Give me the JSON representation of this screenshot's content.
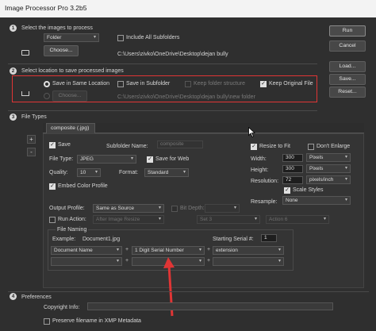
{
  "window": {
    "title": "Image Processor Pro 3.2b5"
  },
  "section1": {
    "number": "1",
    "label": "Select the images to process",
    "source_select": "Folder",
    "include_subfolders": "Include All Subfolders",
    "choose_button": "Choose...",
    "source_path": "C:\\Users\\zivko\\OneDrive\\Desktop\\dejan bully"
  },
  "section2": {
    "number": "2",
    "label": "Select location to save processed images",
    "save_same_location": "Save in Same Location",
    "save_in_subfolder": "Save in Subfolder",
    "keep_folder_structure": "Keep folder structure",
    "keep_original_file": "Keep Original File",
    "choose_button": "Choose...",
    "dest_path": "C:\\Users\\zivko\\OneDrive\\Desktop\\dejan bully\\new folder"
  },
  "section3": {
    "number": "3",
    "label": "File Types",
    "tab_label": "composite (.jpg)",
    "add_icon": "+",
    "remove_icon": "-",
    "save_label": "Save",
    "subfolder_name_label": "Subfolder Name:",
    "subfolder_name_value": "composite",
    "file_type_label": "File Type:",
    "file_type_value": "JPEG",
    "save_for_web": "Save for Web",
    "quality_label": "Quality:",
    "quality_value": "10",
    "format_label": "Format:",
    "format_value": "Standard",
    "embed_color_profile": "Embed Color Profile",
    "resize_to_fit": "Resize to Fit",
    "dont_enlarge": "Don't Enlarge",
    "width_label": "Width:",
    "width_value": "300",
    "width_unit": "Pixels",
    "height_label": "Height:",
    "height_value": "300",
    "height_unit": "Pixels",
    "resolution_label": "Resolution:",
    "resolution_value": "72",
    "resolution_unit": "pixels/inch",
    "scale_styles": "Scale Styles",
    "resample_label": "Resample:",
    "resample_value": "None",
    "output_profile_label": "Output Profile:",
    "output_profile_value": "Same as Source",
    "bit_depth_label": "Bit Depth:",
    "run_action_label": "Run Action:",
    "run_action_when": "After Image Resize",
    "action_set": "Set 3",
    "action_name": "Action 6",
    "file_naming_label": "File Naming",
    "example_label": "Example:",
    "example_value": "Document1.jpg",
    "starting_serial_label": "Starting Serial #:",
    "starting_serial_value": "1",
    "naming_1": "Document Name",
    "naming_2": "1 Digit Serial Number",
    "naming_3": "extension",
    "plus": "+"
  },
  "section4": {
    "number": "4",
    "label": "Preferences",
    "copyright_label": "Copyright Info:",
    "preserve_filename": "Preserve filename in XMP Metadata"
  },
  "buttons": {
    "run": "Run",
    "cancel": "Cancel",
    "load": "Load...",
    "save": "Save...",
    "reset": "Reset..."
  },
  "colors": {
    "highlight_box": "#e03535",
    "arrow": "#e03535"
  }
}
